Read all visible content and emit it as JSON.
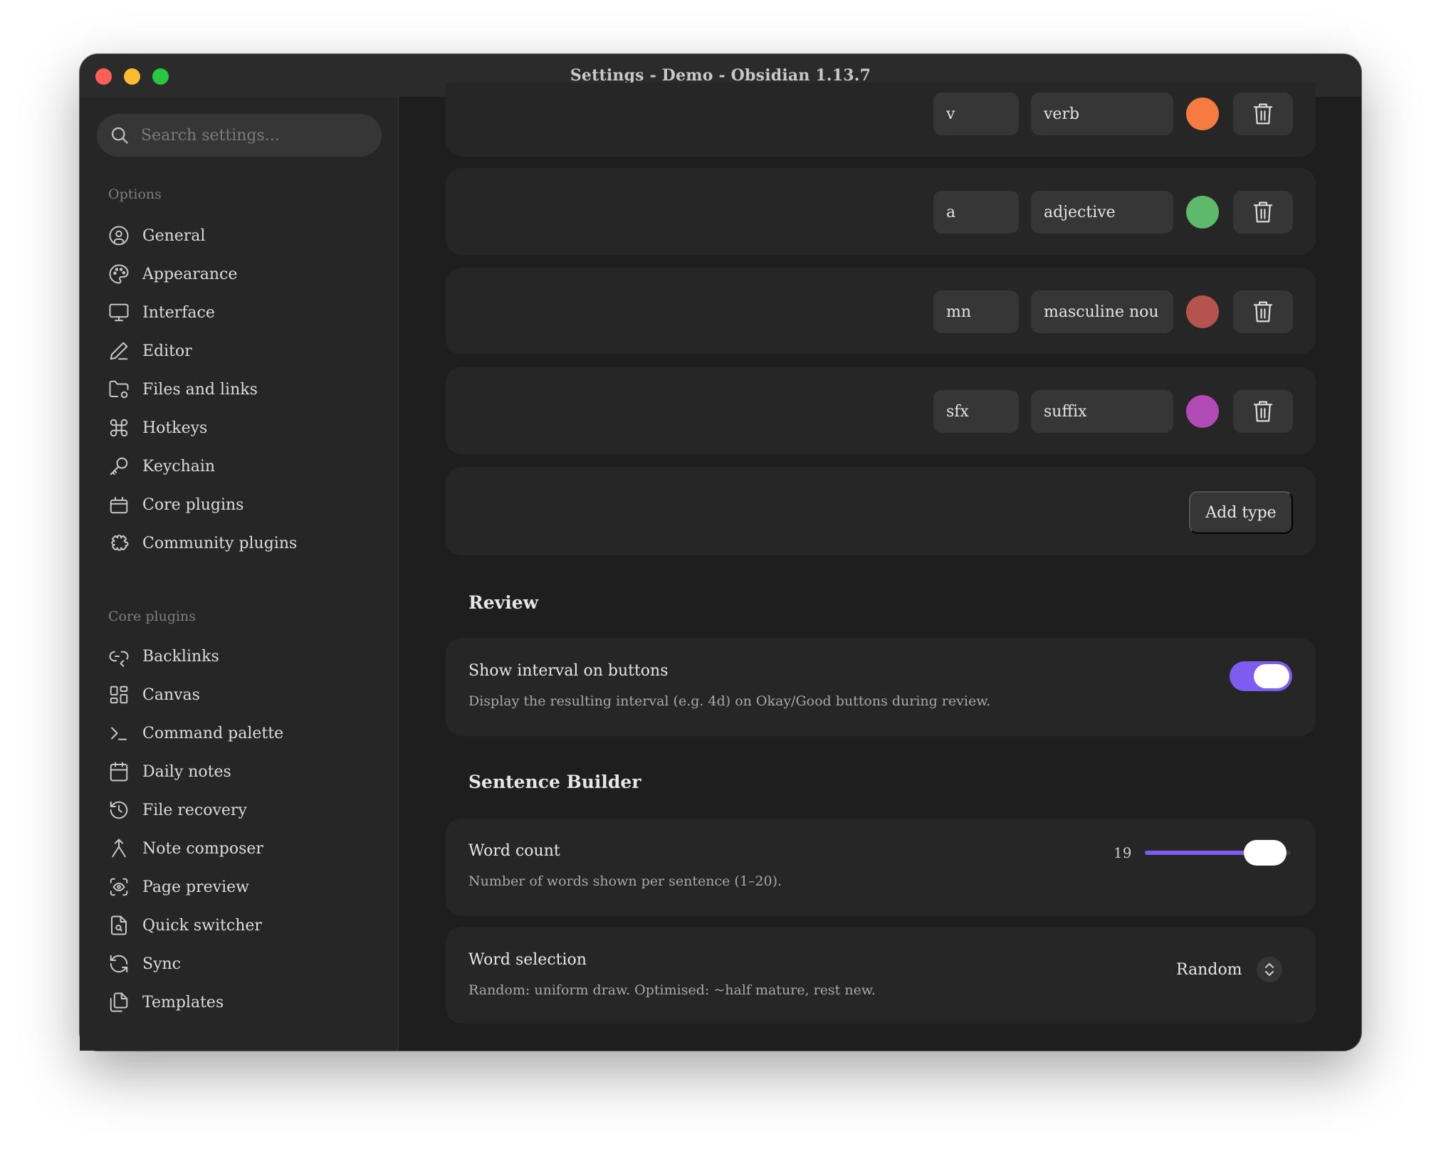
{
  "window": {
    "title": "Settings - Demo - Obsidian 1.13.7"
  },
  "search": {
    "placeholder": "Search settings..."
  },
  "sidebar": {
    "options_label": "Options",
    "options": [
      {
        "label": "General",
        "icon": "user-circle-icon"
      },
      {
        "label": "Appearance",
        "icon": "palette-icon"
      },
      {
        "label": "Interface",
        "icon": "monitor-icon"
      },
      {
        "label": "Editor",
        "icon": "pencil-icon"
      },
      {
        "label": "Files and links",
        "icon": "folder-cog-icon"
      },
      {
        "label": "Hotkeys",
        "icon": "command-icon"
      },
      {
        "label": "Keychain",
        "icon": "key-icon"
      },
      {
        "label": "Core plugins",
        "icon": "plugin-box-icon"
      },
      {
        "label": "Community plugins",
        "icon": "puzzle-icon"
      }
    ],
    "core_plugins_label": "Core plugins",
    "core_plugins": [
      {
        "label": "Backlinks",
        "icon": "backlink-icon"
      },
      {
        "label": "Canvas",
        "icon": "layout-grid-icon"
      },
      {
        "label": "Command palette",
        "icon": "terminal-icon"
      },
      {
        "label": "Daily notes",
        "icon": "calendar-icon"
      },
      {
        "label": "File recovery",
        "icon": "history-icon"
      },
      {
        "label": "Note composer",
        "icon": "merge-icon"
      },
      {
        "label": "Page preview",
        "icon": "eye-scan-icon"
      },
      {
        "label": "Quick switcher",
        "icon": "file-search-icon"
      },
      {
        "label": "Sync",
        "icon": "refresh-icon"
      },
      {
        "label": "Templates",
        "icon": "files-icon"
      }
    ]
  },
  "word_types": [
    {
      "abbr": "v",
      "name": "verb",
      "color": "#f77a41"
    },
    {
      "abbr": "a",
      "name": "adjective",
      "color": "#5fb96a"
    },
    {
      "abbr": "mn",
      "name": "masculine nou",
      "color": "#b5544e"
    },
    {
      "abbr": "sfx",
      "name": "suffix",
      "color": "#b04bb5"
    }
  ],
  "add_type_label": "Add type",
  "review": {
    "heading": "Review",
    "show_interval": {
      "name": "Show interval on buttons",
      "desc": "Display the resulting interval (e.g. 4d) on Okay/Good buttons during review.",
      "enabled": true
    }
  },
  "sentence_builder": {
    "heading": "Sentence Builder",
    "word_count": {
      "name": "Word count",
      "desc": "Number of words shown per sentence (1–20).",
      "value": "19",
      "min": 1,
      "max": 20
    },
    "word_selection": {
      "name": "Word selection",
      "desc": "Random: uniform draw. Optimised: ~half mature, rest new.",
      "selected": "Random"
    }
  },
  "colors": {
    "accent": "#7f5cf0",
    "background": "#1e1e1e",
    "sidebar": "#262626"
  }
}
